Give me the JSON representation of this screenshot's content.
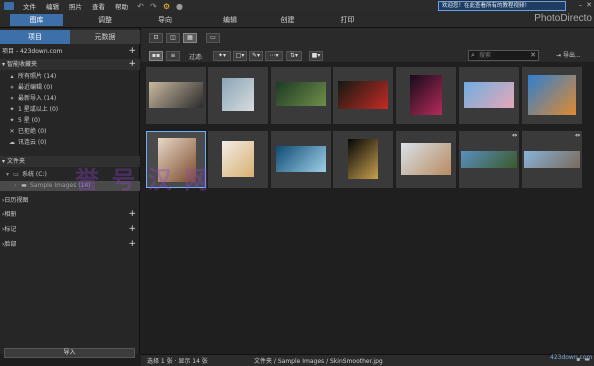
{
  "menu": {
    "items": [
      "文件",
      "编辑",
      "照片",
      "查看",
      "帮助"
    ]
  },
  "welcome_banner": "欢迎您！在此查看所有的教程视频！",
  "app_brand": "PhotoDirecto",
  "module_tabs": [
    {
      "label": "图库",
      "active": true
    },
    {
      "label": "调整"
    },
    {
      "label": "导向"
    },
    {
      "label": "编辑"
    },
    {
      "label": "创建"
    },
    {
      "label": "打印"
    }
  ],
  "left_panel": {
    "tabs": [
      "项目",
      "元数据"
    ],
    "project_header": "项目 - 423down.com",
    "smart_collections_header": "智能收藏夹",
    "smart_collections": [
      {
        "label": "所有照片 (14)",
        "icon": "all-photos-icon"
      },
      {
        "label": "最近编辑 (0)",
        "icon": "recent-edit-icon"
      },
      {
        "label": "最新导入 (14)",
        "icon": "recent-import-icon"
      },
      {
        "label": "1 星或以上 (0)",
        "icon": "star-icon"
      },
      {
        "label": "5 星 (0)",
        "icon": "star-icon"
      },
      {
        "label": "已拒绝 (0)",
        "icon": "reject-icon"
      },
      {
        "label": "讯连云 (0)",
        "icon": "cloud-icon"
      }
    ],
    "folders_header": "文件夹",
    "folders": [
      {
        "label": "系统 (C:)"
      },
      {
        "label": "Sample Images (14)"
      }
    ],
    "sections": [
      "日历视图",
      "相册",
      "标记",
      "脸部"
    ],
    "import_button": "导入"
  },
  "toolbar": {
    "filter_label": "过滤:",
    "search_placeholder": "搜索",
    "export_label": "导出..."
  },
  "thumbnails": [
    {
      "name": "concert-crowd",
      "colors": [
        "#c9b9a0",
        "#2c2c2c"
      ]
    },
    {
      "name": "water-splash-figure",
      "colors": [
        "#8aa5b5",
        "#d8dcdf"
      ]
    },
    {
      "name": "forest-path",
      "colors": [
        "#1c3a22",
        "#6f8f4a"
      ]
    },
    {
      "name": "red-poppy",
      "colors": [
        "#121a12",
        "#c52a25"
      ]
    },
    {
      "name": "night-street-neon",
      "colors": [
        "#140c1a",
        "#b52a5a"
      ]
    },
    {
      "name": "colored-smoke",
      "colors": [
        "#6faee0",
        "#e6a8b8"
      ]
    },
    {
      "name": "skydiver-blue-sky",
      "colors": [
        "#2f7fd0",
        "#e08a30"
      ]
    },
    {
      "name": "woman-portrait-smile",
      "colors": [
        "#e8d8c8",
        "#7a4a2a"
      ]
    },
    {
      "name": "blonde-portrait",
      "colors": [
        "#f2ece6",
        "#d8b070"
      ]
    },
    {
      "name": "ocean-wave",
      "colors": [
        "#0e4a73",
        "#9fd0e8"
      ]
    },
    {
      "name": "dark-window-light",
      "colors": [
        "#050505",
        "#c8a050"
      ]
    },
    {
      "name": "woman-sofa",
      "colors": [
        "#d9e2ea",
        "#b88a60"
      ]
    },
    {
      "name": "panorama-landscape",
      "colors": [
        "#5a8fc0",
        "#3a5a2a"
      ]
    },
    {
      "name": "panorama-clouds",
      "colors": [
        "#89b3da",
        "#7a6a5a"
      ]
    }
  ],
  "status": {
    "selection": "选择 1 张 · 显示 14 张",
    "path": "文件夹 / Sample Images / SkinSmoother.jpg"
  },
  "watermark": "誉 号 汉 网",
  "site_mark": "423down.com"
}
